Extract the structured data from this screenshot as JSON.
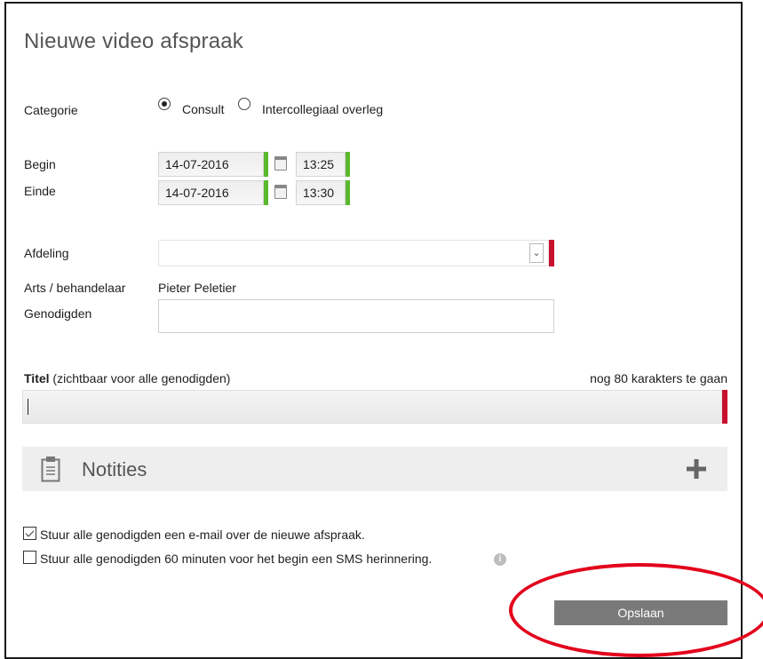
{
  "dialog": {
    "title": "Nieuwe video afspraak"
  },
  "category": {
    "label": "Categorie",
    "options": [
      {
        "label": "Consult",
        "selected": true
      },
      {
        "label": "Intercollegiaal overleg",
        "selected": false
      }
    ]
  },
  "begin": {
    "label": "Begin",
    "date": "14-07-2016",
    "time": "13:25"
  },
  "end": {
    "label": "Einde",
    "date": "14-07-2016",
    "time": "13:30"
  },
  "department": {
    "label": "Afdeling",
    "value": ""
  },
  "doctor": {
    "label": "Arts / behandelaar",
    "value": "Pieter Peletier"
  },
  "invitees": {
    "label": "Genodigden",
    "value": ""
  },
  "titlefield": {
    "label_bold": "Titel",
    "label_rest": "(zichtbaar voor alle genodigden)",
    "counter": "nog 80 karakters te gaan",
    "value": ""
  },
  "notes": {
    "label": "Notities",
    "icon": "clipboard-icon",
    "expand_icon": "plus-icon"
  },
  "options": {
    "email_label": "Stuur alle genodigden een e-mail over de nieuwe afspraak.",
    "email_checked": true,
    "sms_label": "Stuur alle genodigden 60 minuten voor het begin een SMS herinnering.",
    "sms_checked": false
  },
  "actions": {
    "save_label": "Opslaan"
  },
  "colors": {
    "valid": "#5cb82e",
    "invalid": "#c8102e",
    "annotation": "#e3001b",
    "save_button": "#7a7a7a"
  }
}
